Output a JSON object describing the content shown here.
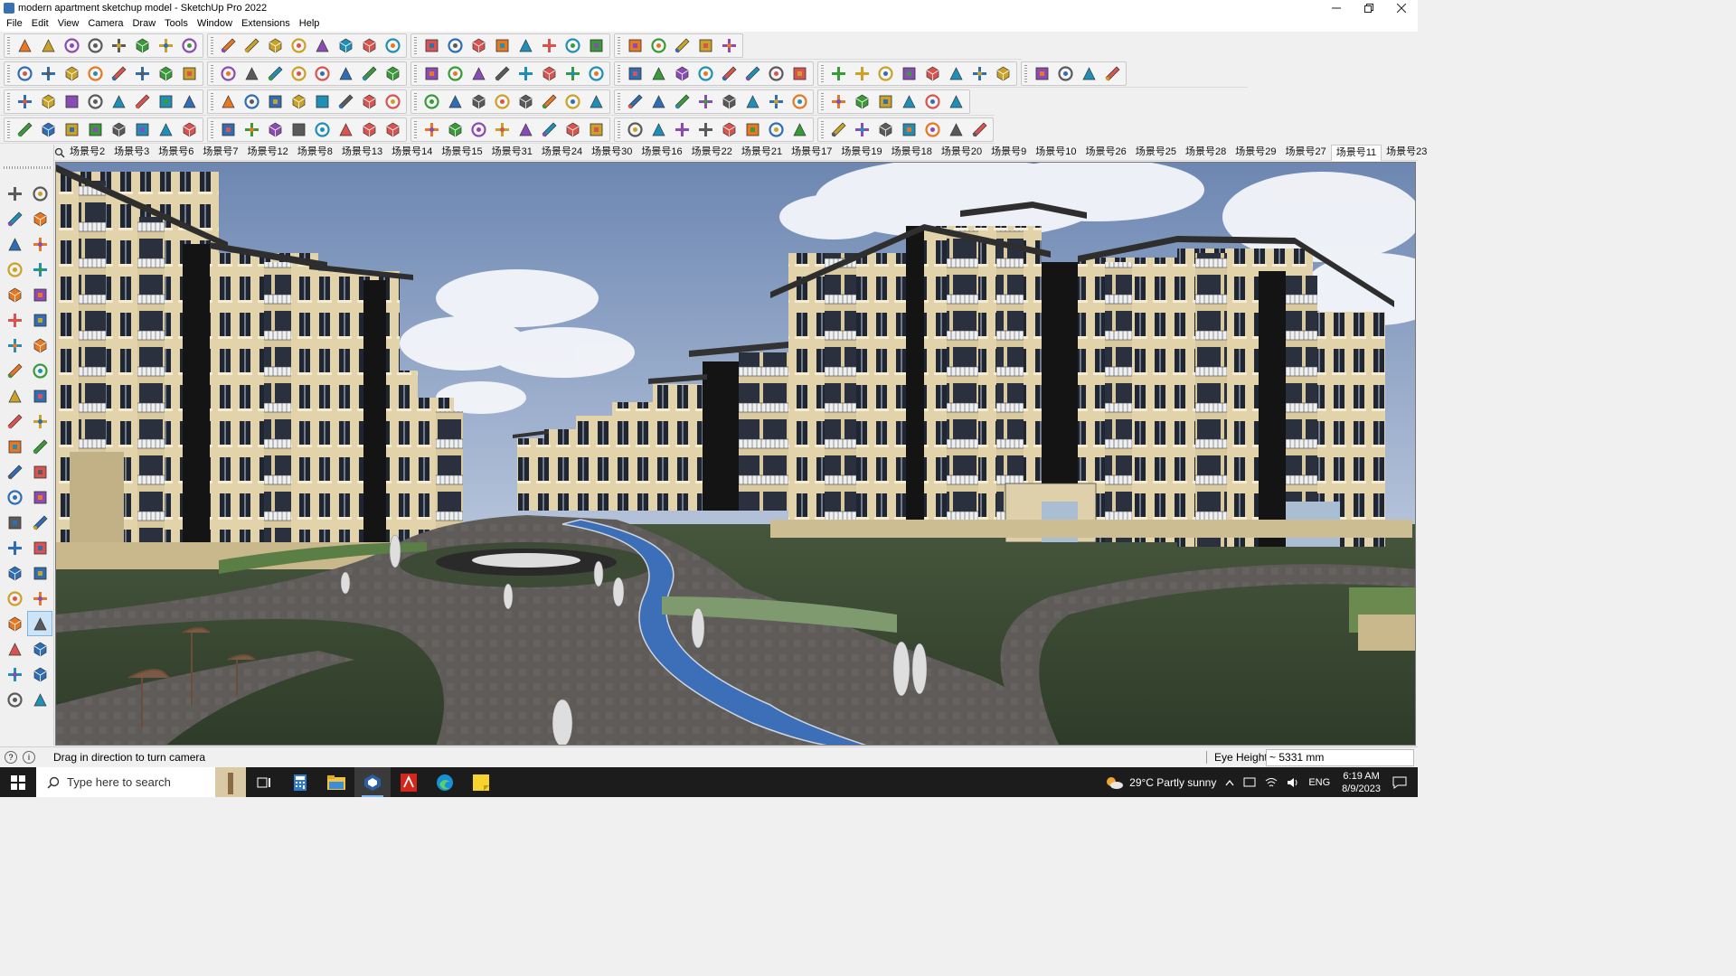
{
  "window": {
    "title": "modern apartment sketchup model - SketchUp Pro 2022",
    "controls": [
      "minimize",
      "maximize",
      "close"
    ]
  },
  "menu": [
    "File",
    "Edit",
    "View",
    "Camera",
    "Draw",
    "Tools",
    "Window",
    "Extensions",
    "Help"
  ],
  "toolbars": {
    "row1": [
      "zoom-icon",
      "select-icon",
      "eraser-icon",
      "pencil-icon",
      "lasso-icon",
      "rectangle-icon",
      "push-pull-icon",
      "follow-me-icon",
      "move-icon",
      "rotate-icon",
      "scale-icon",
      "tape-measure-icon",
      "text-icon",
      "paint-icon",
      "orbit-icon",
      "pan-icon",
      "zoom-window-icon",
      "zoom-extents-icon",
      "warehouse-icon",
      "extension-icon",
      "layers-icon",
      "styles-icon",
      "user-icon",
      "sandbox-icon",
      "flip-icon",
      "flip2-icon",
      "align-icon",
      "undo-icon",
      "redo-icon"
    ],
    "row2": [
      "solid-icon",
      "cube-icon",
      "cube2-icon",
      "push-pull-icon",
      "extrude-icon",
      "extrude2-icon",
      "extrude3-icon",
      "extrude4-icon",
      "extrude5-icon",
      "extrude6-icon",
      "extrude7-icon",
      "bend-icon",
      "section-icon",
      "section2-icon",
      "section3-icon",
      "terrain-icon",
      "terrain2-icon",
      "house-icon",
      "house2-icon",
      "house3-icon",
      "house4-icon",
      "house5-icon",
      "function-icon",
      "tag-icon",
      "ruler-icon",
      "shape-icon",
      "circle-icon",
      "polygon-icon",
      "ellipse-icon",
      "parallelogram-icon",
      "arc-icon",
      "wave-icon",
      "bezier-icon",
      "spline-icon",
      "curve-icon",
      "arrow-icon",
      "eraser2-icon",
      "stamp-icon",
      "texture-icon",
      "texture2-icon",
      "texture3-icon",
      "texture4-icon",
      "texture5-icon",
      "texture6-icon"
    ],
    "row3": [
      "plane-icon",
      "plane2-icon",
      "plane3-icon",
      "plane4-icon",
      "plane5-icon",
      "plane6-icon",
      "loop-icon",
      "square-icon",
      "list-icon",
      "page-icon",
      "box-icon",
      "line-icon",
      "fillet-icon",
      "node-icon",
      "cross-icon",
      "join-icon",
      "unjoin-icon",
      "cone-icon",
      "warning-icon",
      "link-icon",
      "chain-icon",
      "rotate3-icon",
      "crosshair-icon",
      "cup-icon",
      "undo2-icon",
      "grid-icon",
      "gear-icon",
      "gear2-icon",
      "gear3-icon",
      "cube3-icon",
      "pattern-icon",
      "frame-icon",
      "tile-icon",
      "tile2-icon",
      "tile3-icon",
      "close-x-icon",
      "spline2-icon",
      "grid2-icon"
    ],
    "row4": [
      "curve2-icon",
      "path-icon",
      "path2-icon",
      "cut-icon",
      "gear4-icon",
      "sweep-icon",
      "hook-icon",
      "pipe-icon",
      "pipe2-icon",
      "stair-icon",
      "stair2-icon",
      "stair3-icon",
      "stair4-icon",
      "stair5-icon",
      "cone2-icon",
      "box2-icon",
      "rail-icon",
      "rail2-icon",
      "spring-icon",
      "curl-icon",
      "leaf-icon",
      "list2-icon",
      "slash-icon",
      "scissors-icon",
      "scissors2-icon",
      "scissors3-icon",
      "bridge-icon",
      "stripe-icon",
      "stripe2-icon",
      "stripe3-icon",
      "stripe4-icon",
      "stripe5-icon",
      "stripe6-icon",
      "stripe7-icon",
      "stripe8-icon",
      "stripe9-icon",
      "stripe10-icon",
      "mesh-icon",
      "mesh2-icon"
    ]
  },
  "scenes": {
    "tabs": [
      "场景号2",
      "场景号3",
      "场景号6",
      "场景号7",
      "场景号12",
      "场景号8",
      "场景号13",
      "场景号14",
      "场景号15",
      "场景号31",
      "场景号24",
      "场景号30",
      "场景号16",
      "场景号22",
      "场景号21",
      "场景号17",
      "场景号19",
      "场景号18",
      "场景号20",
      "场景号9",
      "场景号10",
      "场景号26",
      "场景号25",
      "场景号28",
      "场景号29",
      "场景号27",
      "场景号11",
      "场景号23"
    ],
    "active_index": 26
  },
  "left_tools": [
    "select-icon",
    "orbit-icon",
    "paint-icon",
    "eraser-icon",
    "make-component-icon",
    "tape-icon",
    "pencil-icon",
    "freehand-icon",
    "rectangle-icon",
    "rotated-rect-icon",
    "circle-icon",
    "polygon-icon",
    "arc-icon",
    "arc2-icon",
    "pie-icon",
    "arc3-icon",
    "move-icon",
    "push-pull-icon",
    "rotate-icon",
    "follow-me-icon",
    "scale-icon",
    "offset-icon",
    "tape-measure-icon",
    "dimension-icon",
    "protractor-icon",
    "text-icon",
    "axes-icon",
    "3d-text-icon",
    "orbit2-icon",
    "pan-icon",
    "zoom-icon",
    "zoom-window-icon",
    "zoom-extents-icon",
    "previous-icon",
    "position-camera-icon",
    "look-around-icon",
    "walk-icon",
    "section-plane-icon",
    "warehouse-icon",
    "extension-warehouse-icon",
    "layout-icon",
    "layers-icon"
  ],
  "left_selected_index": 35,
  "status": {
    "hint": "Drag in direction to turn camera",
    "measure_label": "Eye Height",
    "measure_value": "~ 5331 mm"
  },
  "taskbar": {
    "search_placeholder": "Type here to search",
    "apps": [
      "task-view-icon",
      "calculator-icon",
      "file-explorer-icon",
      "sketchup-icon",
      "acrobat-icon",
      "edge-icon",
      "sticky-notes-icon"
    ],
    "weather": "29°C  Partly sunny",
    "lang": "ENG",
    "time": "6:19 AM",
    "date": "8/9/2023"
  },
  "colors": {
    "sky_top": "#6d87b2",
    "building_light": "#e3d4ad",
    "building_dark": "#171717",
    "grass": "#3a4a33",
    "path": "#5c5a58",
    "water": "#3c6fb8",
    "accent": "#0078d7"
  }
}
